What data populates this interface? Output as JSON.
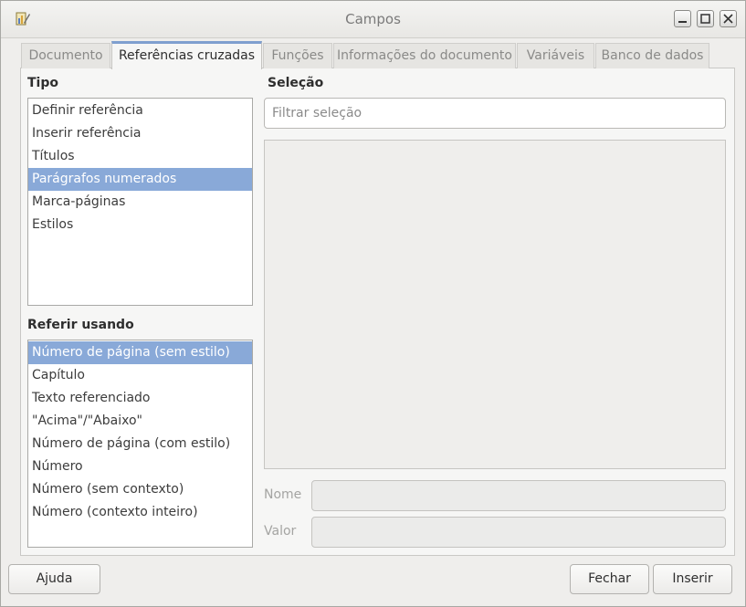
{
  "window": {
    "title": "Campos"
  },
  "tabs": [
    {
      "label": "Documento"
    },
    {
      "label": "Referências cruzadas"
    },
    {
      "label": "Funções"
    },
    {
      "label": "Informações do documento"
    },
    {
      "label": "Variáveis"
    },
    {
      "label": "Banco de dados"
    }
  ],
  "active_tab": "Referências cruzadas",
  "tipo": {
    "label": "Tipo",
    "items": [
      "Definir referência",
      "Inserir referência",
      "Títulos",
      "Parágrafos numerados",
      "Marca-páginas",
      "Estilos"
    ],
    "selected": "Parágrafos numerados"
  },
  "referir": {
    "label": "Referir usando",
    "items": [
      "Número de página (sem estilo)",
      "Capítulo",
      "Texto referenciado",
      "\"Acima\"/\"Abaixo\"",
      "Número de página (com estilo)",
      "Número",
      "Número (sem contexto)",
      "Número (contexto inteiro)"
    ],
    "selected": "Número de página (sem estilo)"
  },
  "selecao": {
    "label": "Seleção",
    "filter_placeholder": "Filtrar seleção",
    "filter_value": ""
  },
  "fields": {
    "nome_label": "Nome",
    "valor_label": "Valor"
  },
  "buttons": {
    "help": "Ajuda",
    "close": "Fechar",
    "insert": "Inserir"
  },
  "colors": {
    "selection": "#89a9d8",
    "active_tab_accent": "#7f9fcf"
  }
}
